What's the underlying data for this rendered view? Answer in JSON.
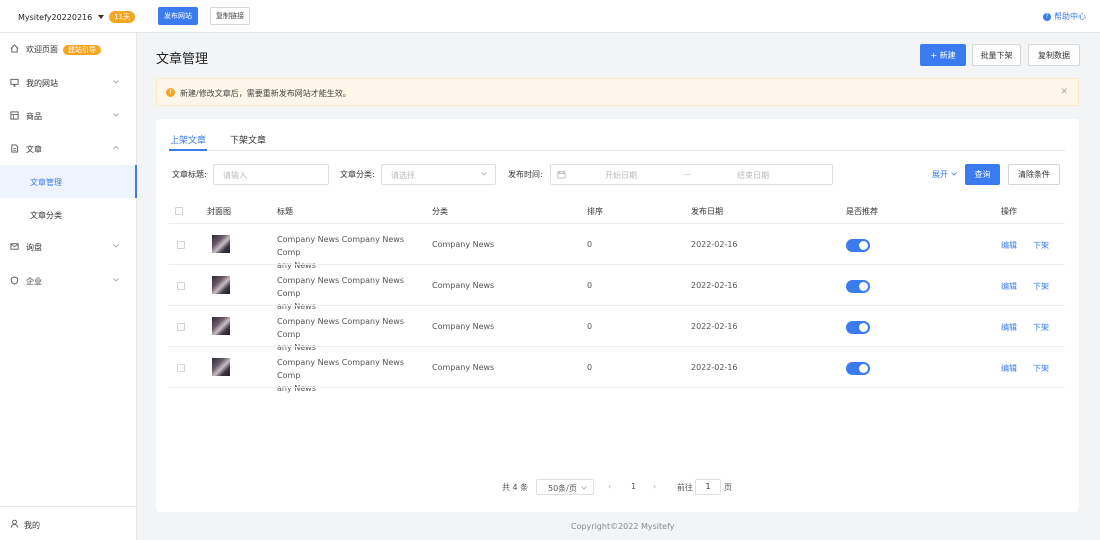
{
  "topbar": {
    "site_name": "Mysitefy20220216",
    "days_badge": "11天",
    "publish_label": "发布网站",
    "copy_link_label": "复制链接",
    "help_label": "帮助中心"
  },
  "sidebar": {
    "items": [
      {
        "label": "欢迎页面",
        "badge": "建站引导"
      },
      {
        "label": "我的网站"
      },
      {
        "label": "商品"
      },
      {
        "label": "文章"
      },
      {
        "label": "询盘"
      },
      {
        "label": "企业"
      }
    ],
    "sub_items": [
      {
        "label": "文章管理"
      },
      {
        "label": "文章分类"
      }
    ],
    "user_label": "我的"
  },
  "page": {
    "title": "文章管理",
    "new_label": "+ 新建",
    "bulk_label": "批量下架",
    "copy_data_label": "复制数据",
    "notice": "新建/修改文章后，需要重新发布网站才能生效。"
  },
  "tabs": [
    {
      "label": "上架文章"
    },
    {
      "label": "下架文章"
    }
  ],
  "filters": {
    "title_label": "文章标题:",
    "title_placeholder": "请输入",
    "category_label": "文章分类:",
    "category_placeholder": "请选择",
    "date_label": "发布时间:",
    "start_placeholder": "开始日期",
    "separator": "—",
    "end_placeholder": "结束日期",
    "expand_label": "展开",
    "query_label": "查询",
    "clear_label": "清除条件"
  },
  "table": {
    "columns": [
      "封面图",
      "标题",
      "分类",
      "排序",
      "发布日期",
      "是否推荐",
      "操作"
    ],
    "rows": [
      {
        "title_line1": "Company News Company News Comp",
        "title_line2": "any News",
        "category": "Company News",
        "sort": "0",
        "date": "2022-02-16",
        "recommended": true,
        "edit": "编辑",
        "off": "下架"
      },
      {
        "title_line1": "Company News Company News Comp",
        "title_line2": "any News",
        "category": "Company News",
        "sort": "0",
        "date": "2022-02-16",
        "recommended": true,
        "edit": "编辑",
        "off": "下架"
      },
      {
        "title_line1": "Company News Company News Comp",
        "title_line2": "any News",
        "category": "Company News",
        "sort": "0",
        "date": "2022-02-16",
        "recommended": true,
        "edit": "编辑",
        "off": "下架"
      },
      {
        "title_line1": "Company News Company News Comp",
        "title_line2": "any News",
        "category": "Company News",
        "sort": "0",
        "date": "2022-02-16",
        "recommended": true,
        "edit": "编辑",
        "off": "下架"
      }
    ]
  },
  "pagination": {
    "total": "共 4 条",
    "page_size": "50条/页",
    "prev": "‹",
    "current": "1",
    "next": "›",
    "goto_label": "前往",
    "goto_value": "1",
    "page_suffix": "页"
  },
  "footer": {
    "copyright": "Copyright©2022  Mysitefy"
  },
  "colors": {
    "accent": "#3a7bf0",
    "badge": "#f5a623",
    "notice_bg": "#fdf6e9"
  }
}
